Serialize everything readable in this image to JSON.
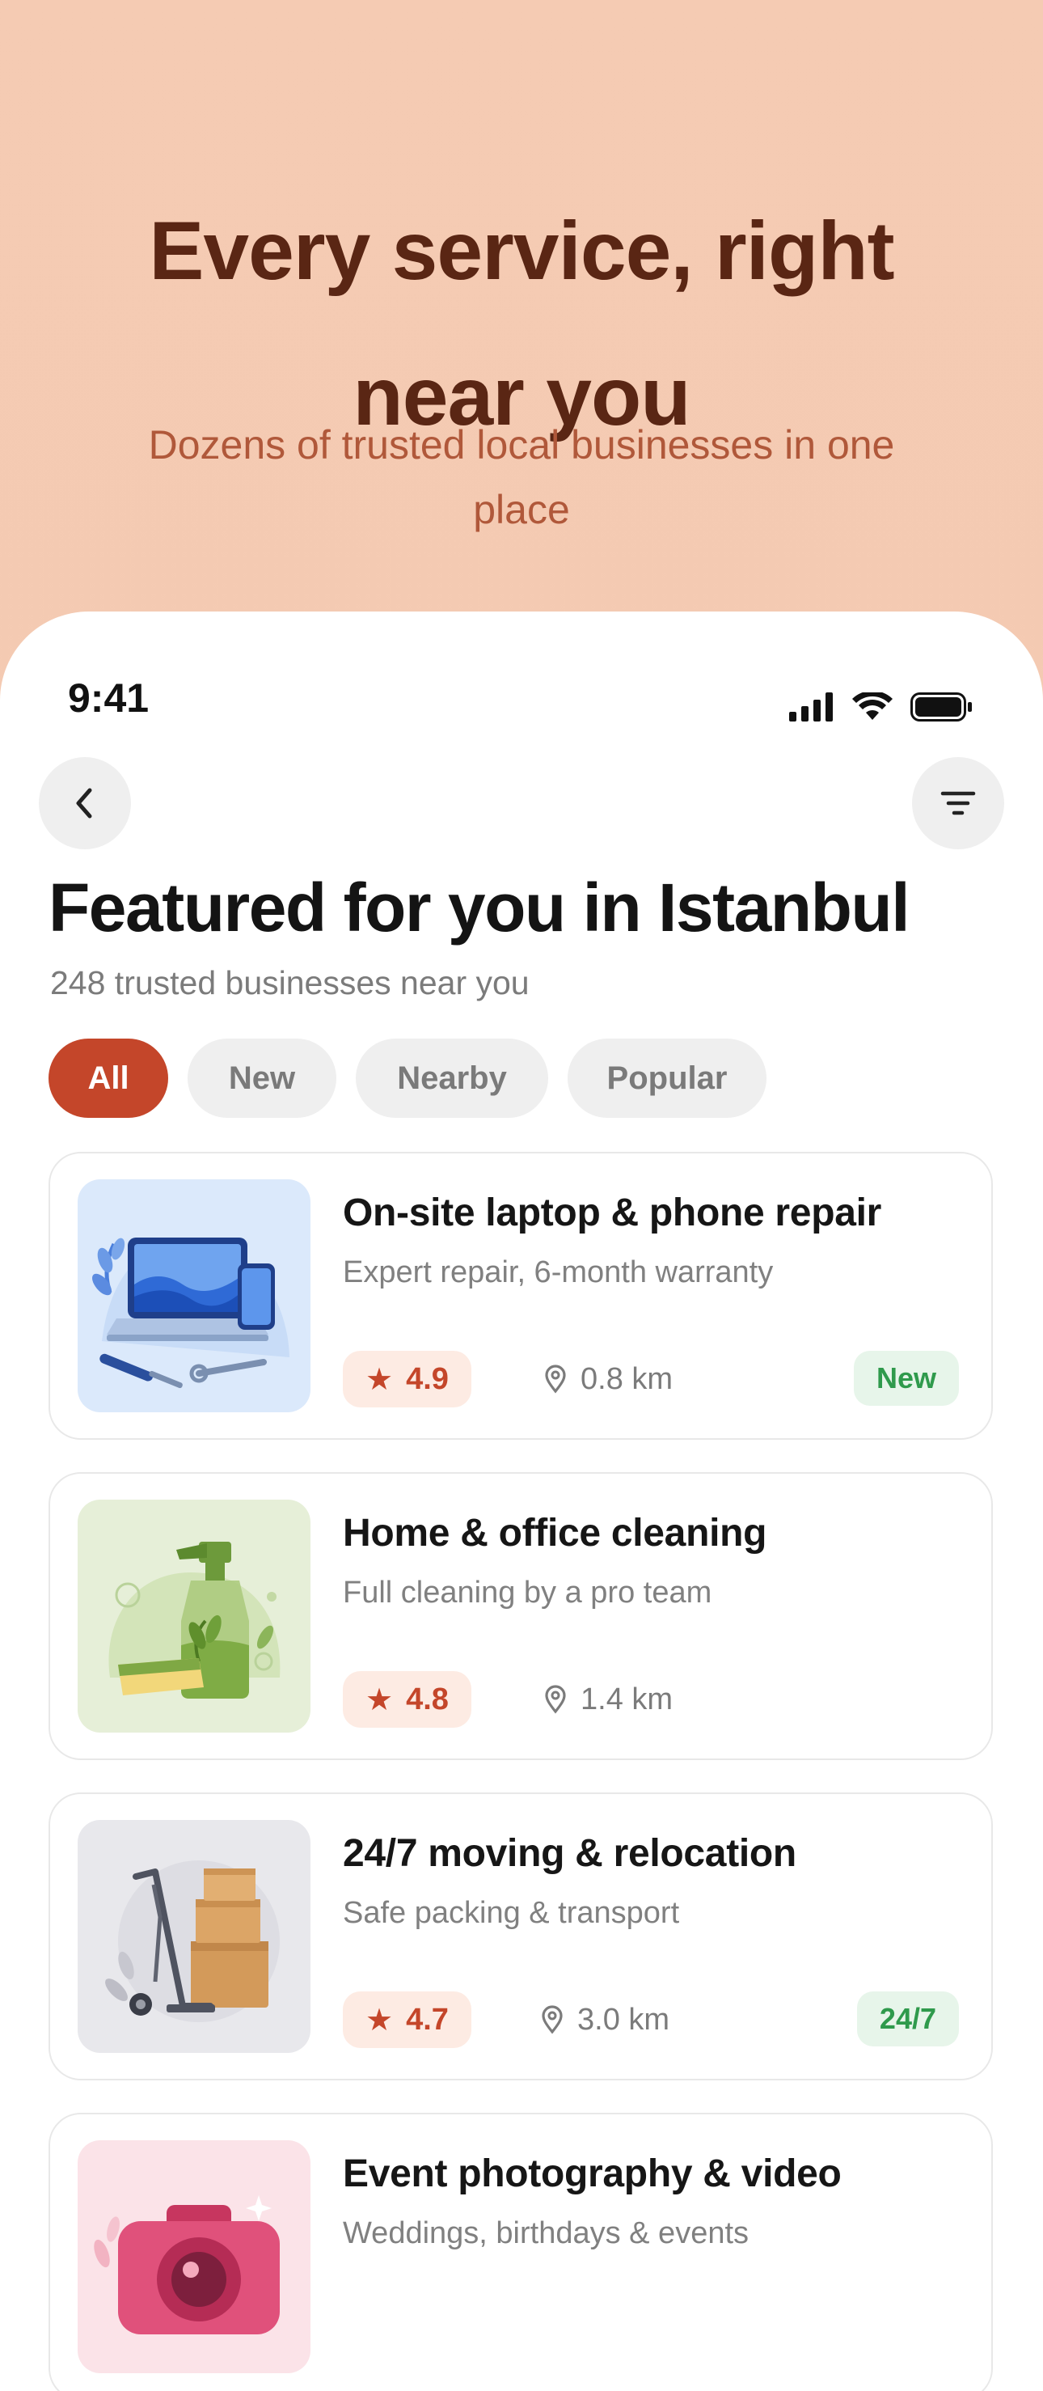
{
  "hero": {
    "title_line1": "Every service, right",
    "title_line2": "near you",
    "subtitle": "Dozens of trusted local businesses in one place"
  },
  "status_bar": {
    "time": "9:41"
  },
  "header": {
    "title": "Featured for you in Istanbul",
    "subtitle": "248 trusted businesses near you"
  },
  "filters": [
    {
      "label": "All",
      "active": true
    },
    {
      "label": "New",
      "active": false
    },
    {
      "label": "Nearby",
      "active": false
    },
    {
      "label": "Popular",
      "active": false
    }
  ],
  "listings": [
    {
      "title": "On-site laptop & phone repair",
      "description": "Expert repair, 6-month warranty",
      "rating": "4.9",
      "distance": "0.8 km",
      "tag": "New",
      "image": "laptop-phone-repair-illustration"
    },
    {
      "title": "Home & office cleaning",
      "description": "Full cleaning by a pro team",
      "rating": "4.8",
      "distance": "1.4 km",
      "tag": "",
      "image": "cleaning-spray-sponge-illustration"
    },
    {
      "title": "24/7 moving & relocation",
      "description": "Safe packing & transport",
      "rating": "4.7",
      "distance": "3.0 km",
      "tag": "24/7",
      "image": "moving-boxes-handtruck-illustration"
    },
    {
      "title": "Event photography & video",
      "description": "Weddings, birthdays & events",
      "rating": "",
      "distance": "",
      "tag": "",
      "image": "pink-camera-illustration"
    }
  ],
  "colors": {
    "hero_background": "#f3cbb4",
    "hero_title": "#5a2614",
    "hero_subtitle": "#b0583a",
    "accent": "#c4462a",
    "rating_background": "#fdebe3",
    "tag_green": "#2f9a4c",
    "tag_background": "#e7f5ea"
  },
  "icons": [
    "back-chevron-icon",
    "filter-icon",
    "star-icon",
    "location-pin-icon",
    "signal-icon",
    "wifi-icon",
    "battery-icon"
  ]
}
